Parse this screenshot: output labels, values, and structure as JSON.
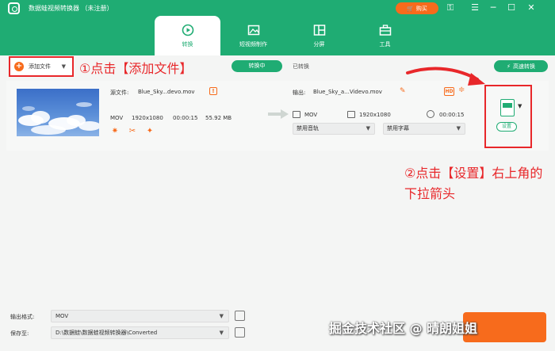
{
  "app": {
    "title": "数据蛙视频转换器 （未注册）",
    "buy_label": "购买"
  },
  "tabs": [
    {
      "label": "转换",
      "active": true
    },
    {
      "label": "短视频制作",
      "active": false
    },
    {
      "label": "分屏",
      "active": false
    },
    {
      "label": "工具",
      "active": false
    }
  ],
  "toolbar": {
    "add_file_label": "添加文件",
    "converting_label": "转换中",
    "converted_label": "已转换",
    "fast_convert_label": "高速转换"
  },
  "file": {
    "source_label": "源文件:",
    "source_name": "Blue_Sky...devo.mov",
    "format": "MOV",
    "resolution": "1920x1080",
    "duration": "00:00:15",
    "size": "55.92 MB",
    "output_label": "输出:",
    "output_name": "Blue_Sky_a...Videvo.mov",
    "output_format": "MOV",
    "output_resolution": "1920x1080",
    "output_duration": "00:00:15",
    "audio_track": "禁用音轨",
    "subtitle": "禁用字幕",
    "settings_label": "设置"
  },
  "annotations": {
    "step1": "①点击【添加文件】",
    "step2": "②点击【设置】右上角的下拉箭头"
  },
  "bottom": {
    "output_format_label": "输出格式:",
    "output_format_value": "MOV",
    "save_to_label": "保存至:",
    "save_to_value": "D:\\数据蛙\\数据蛙视频转换器\\Converted"
  },
  "watermark": "掘金技术社区 @ 晴朗姐姐",
  "colors": {
    "brand_green": "#1fac73",
    "accent_orange": "#f76b1c",
    "annotation_red": "#e8272a"
  }
}
